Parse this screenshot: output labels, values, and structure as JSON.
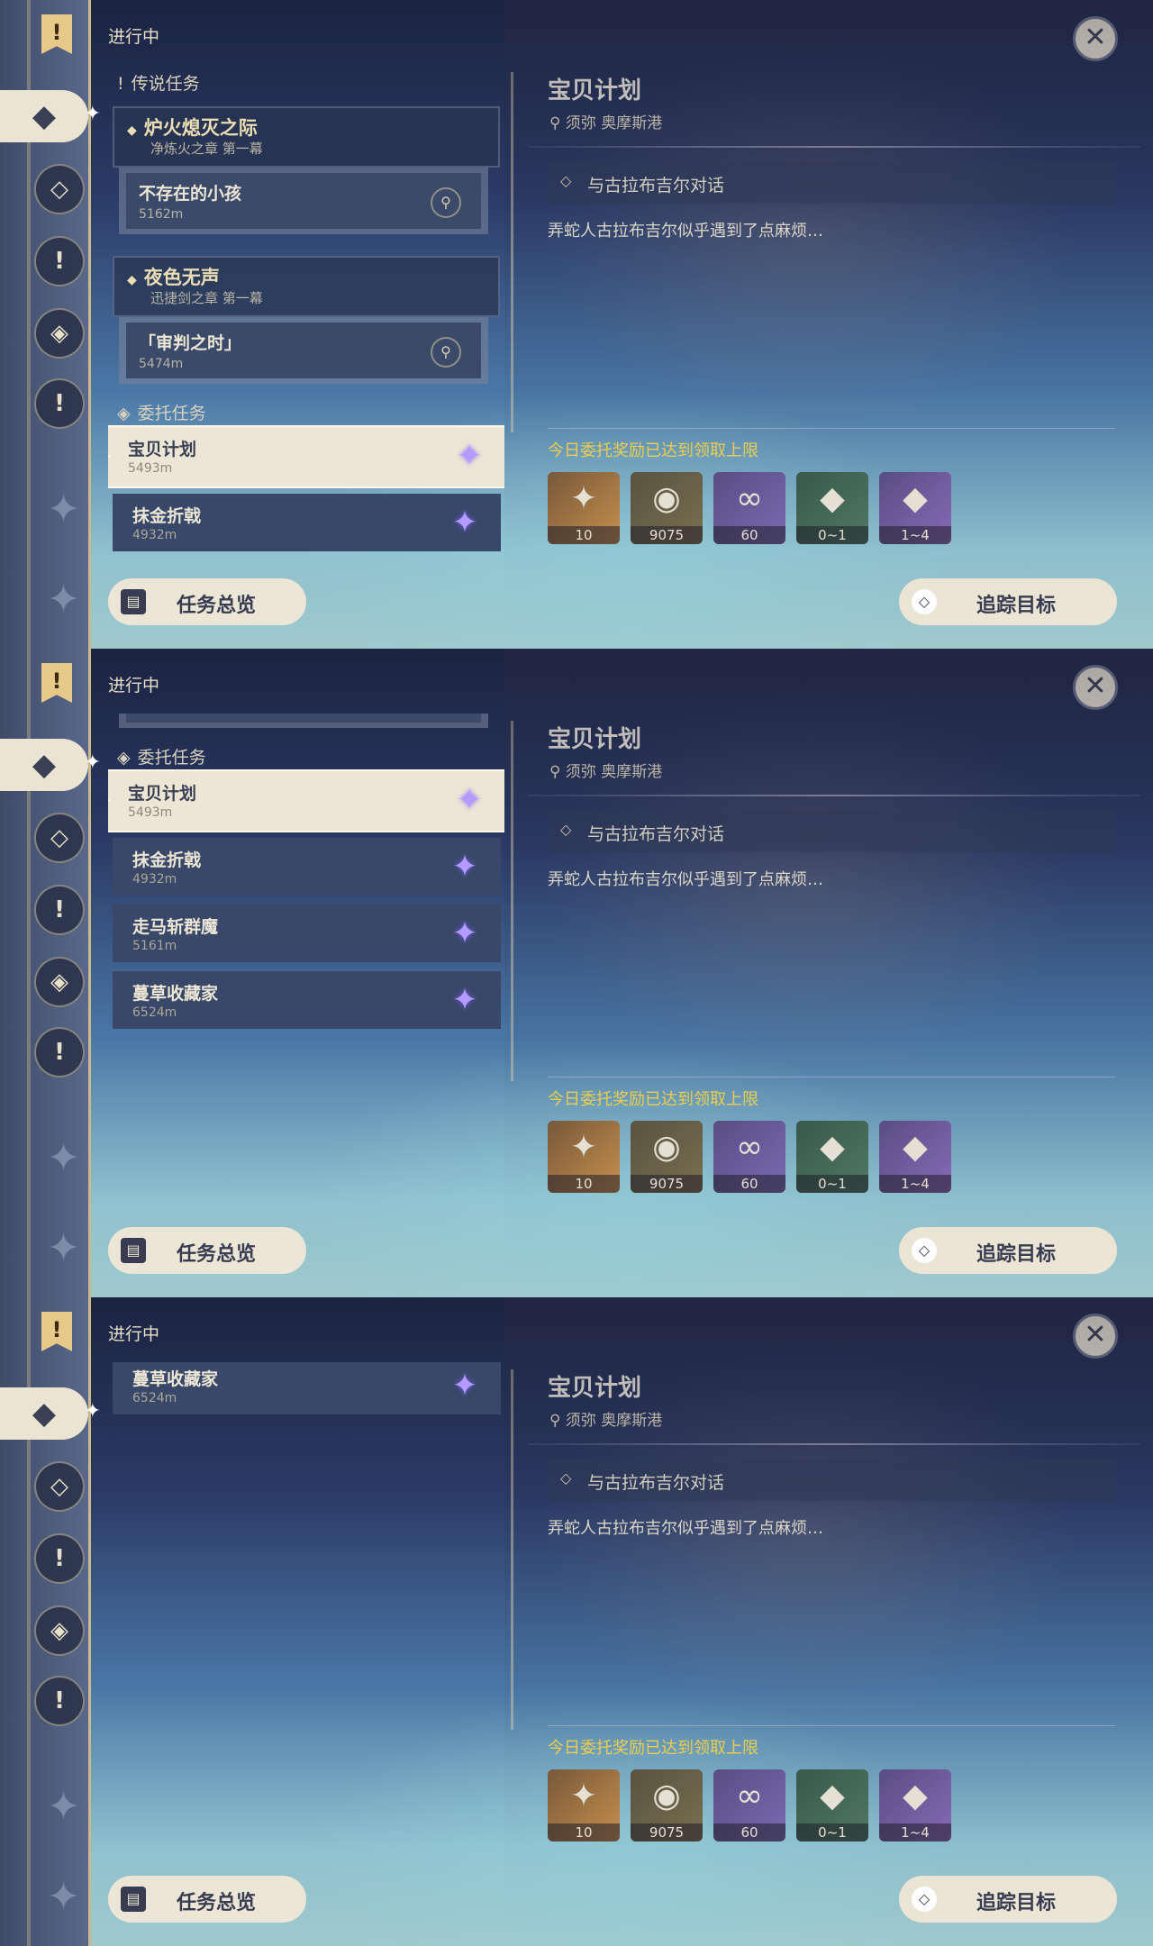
{
  "in_progress_label": "进行中",
  "sections": {
    "legend": "传说任务",
    "commission": "委托任务"
  },
  "legend_quests": [
    {
      "title": "炉火熄灭之际",
      "chapter": "净炼火之章 第一幕",
      "sub": {
        "title": "不存在的小孩",
        "distance": "5162m"
      }
    },
    {
      "title": "夜色无声",
      "chapter": "迅捷剑之章 第一幕",
      "sub": {
        "title": "「审判之时」",
        "distance": "5474m"
      }
    }
  ],
  "commissions": [
    {
      "title": "宝贝计划",
      "distance": "5493m"
    },
    {
      "title": "抹金折戟",
      "distance": "4932m"
    },
    {
      "title": "走马斩群魔",
      "distance": "5161m"
    },
    {
      "title": "蔓草收藏家",
      "distance": "6524m"
    }
  ],
  "detail": {
    "title": "宝贝计划",
    "location": "须弥 奥摩斯港",
    "objective": "与古拉布吉尔对话",
    "description": "弄蛇人古拉布吉尔似乎遇到了点麻烦…",
    "reward_notice": "今日委托奖励已达到领取上限",
    "rewards": [
      {
        "icon": "star-shard-icon",
        "count": "10"
      },
      {
        "icon": "mora-coin-icon",
        "count": "9075"
      },
      {
        "icon": "companionship-icon",
        "count": "60"
      },
      {
        "icon": "crystal-icon",
        "count": "0~1"
      },
      {
        "icon": "crystal-cluster-icon",
        "count": "1~4"
      }
    ]
  },
  "buttons": {
    "overview": "任务总览",
    "track": "追踪目标",
    "close": "✕"
  },
  "rail_icons": [
    "quest-flag-icon",
    "commission-icon",
    "archon-icon",
    "story-icon",
    "world-icon",
    "event-icon"
  ]
}
